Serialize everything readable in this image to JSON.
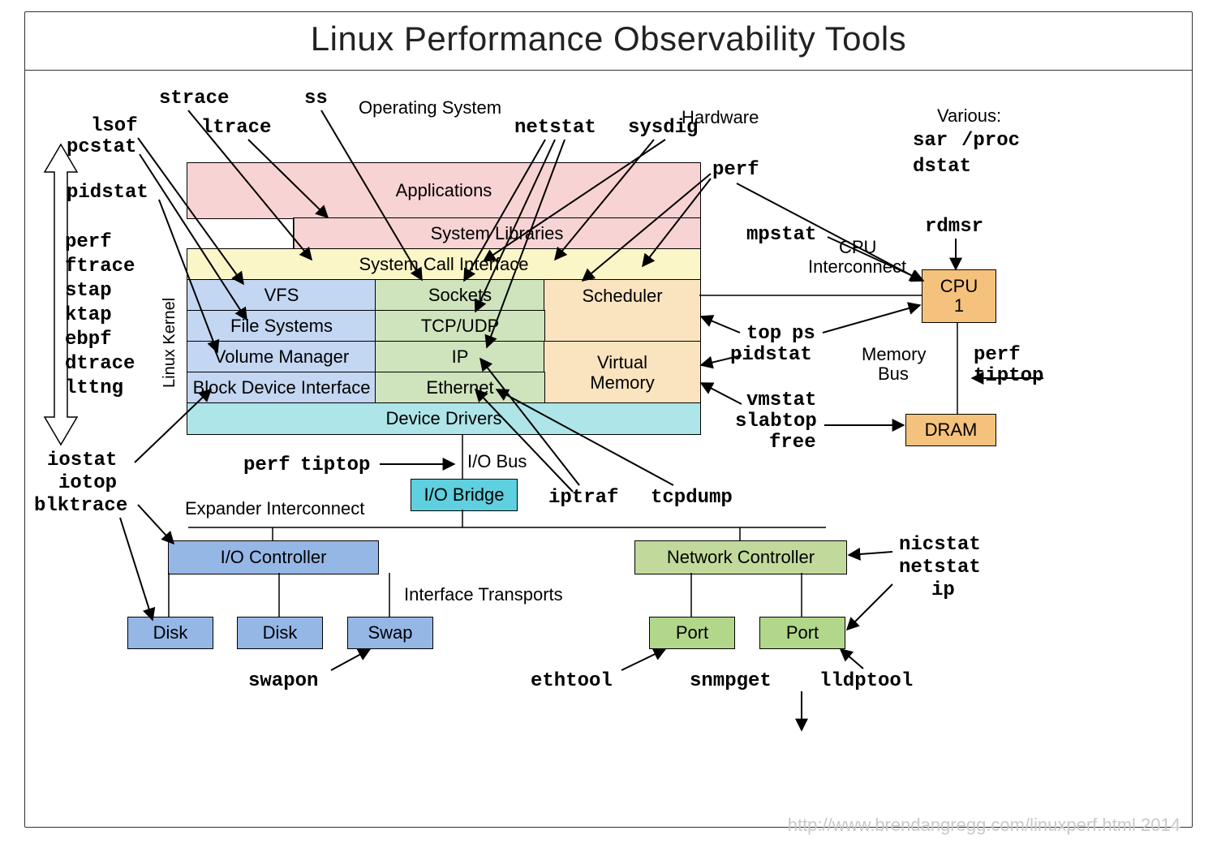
{
  "title": "Linux Performance Observability Tools",
  "footer": "http://www.brendangregg.com/linuxperf.html 2014",
  "labels": {
    "operating_system": "Operating System",
    "hardware": "Hardware",
    "various": "Various:",
    "linux_kernel": "Linux Kernel",
    "cpu_interconnect1": "CPU",
    "cpu_interconnect2": "Interconnect",
    "memory_bus1": "Memory",
    "memory_bus2": "Bus",
    "io_bus": "I/O Bus",
    "expander": "Expander Interconnect",
    "interface_transports": "Interface Transports"
  },
  "blocks": {
    "applications": "Applications",
    "syslib": "System Libraries",
    "syscall": "System Call Interface",
    "vfs": "VFS",
    "sockets": "Sockets",
    "scheduler": "Scheduler",
    "filesystems": "File Systems",
    "tcpudp": "TCP/UDP",
    "volmgr": "Volume Manager",
    "ip": "IP",
    "blockdev": "Block Device Interface",
    "ethernet": "Ethernet",
    "virtmem": "Virtual\nMemory",
    "drivers": "Device Drivers",
    "iobridge": "I/O Bridge",
    "iocontroller": "I/O Controller",
    "netcontroller": "Network Controller",
    "disk1": "Disk",
    "disk2": "Disk",
    "swap": "Swap",
    "port1": "Port",
    "port2": "Port",
    "cpu1": "CPU",
    "cpu1n": "1",
    "dram": "DRAM"
  },
  "tools": {
    "strace": "strace",
    "ss": "ss",
    "lsof": "lsof",
    "ltrace": "ltrace",
    "pcstat": "pcstat",
    "pidstat": "pidstat",
    "netstat": "netstat",
    "sysdig": "sysdig",
    "perf": "perf",
    "mpstat": "mpstat",
    "rdmsr": "rdmsr",
    "sar": "sar",
    "proc": "/proc",
    "dstat": "dstat",
    "top": "top",
    "ps": "ps",
    "pidstat2": "pidstat",
    "perf2": "perf",
    "tiptop": "tiptop",
    "vmstat": "vmstat",
    "slabtop": "slabtop",
    "free": "free",
    "perf_list": "perf\nftrace\nstap\nktap\nebpf\ndtrace\nlttng",
    "iostat": "iostat",
    "iotop": "iotop",
    "blktrace": "blktrace",
    "perf3": "perf",
    "tiptop2": "tiptop",
    "swapon": "swapon",
    "ethtool": "ethtool",
    "snmpget": "snmpget",
    "lldptool": "lldptool",
    "iptraf": "iptraf",
    "tcpdump": "tcpdump",
    "nicstat": "nicstat",
    "netstat2": "netstat",
    "ip2": "ip"
  }
}
